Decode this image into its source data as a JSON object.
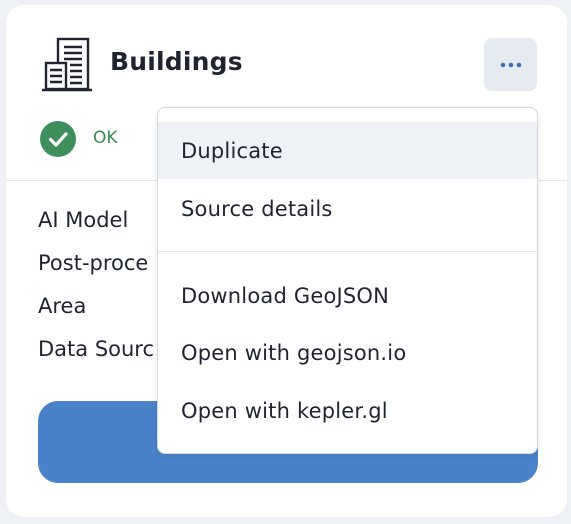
{
  "card": {
    "title": "Buildings",
    "status": "OK",
    "labels": [
      "AI Model",
      "Post-proce",
      "Area",
      "Data Sourc"
    ]
  },
  "menu": {
    "items": [
      {
        "label": "Duplicate",
        "highlighted": true
      },
      {
        "label": "Source details",
        "highlighted": false
      },
      {
        "label": "Download GeoJSON",
        "highlighted": false
      },
      {
        "label": "Open with geojson.io",
        "highlighted": false
      },
      {
        "label": "Open with kepler.gl",
        "highlighted": false
      }
    ]
  },
  "icons": {
    "header": "buildings-icon",
    "more": "more-horizontal-icon",
    "status": "check-circle-icon"
  },
  "colors": {
    "accent": "#4a82c9",
    "status_green": "#3a8a55",
    "status_circle": "#3f8f5c",
    "menu_highlight": "#eef1f5",
    "more_button_bg": "#e6eaf1"
  }
}
